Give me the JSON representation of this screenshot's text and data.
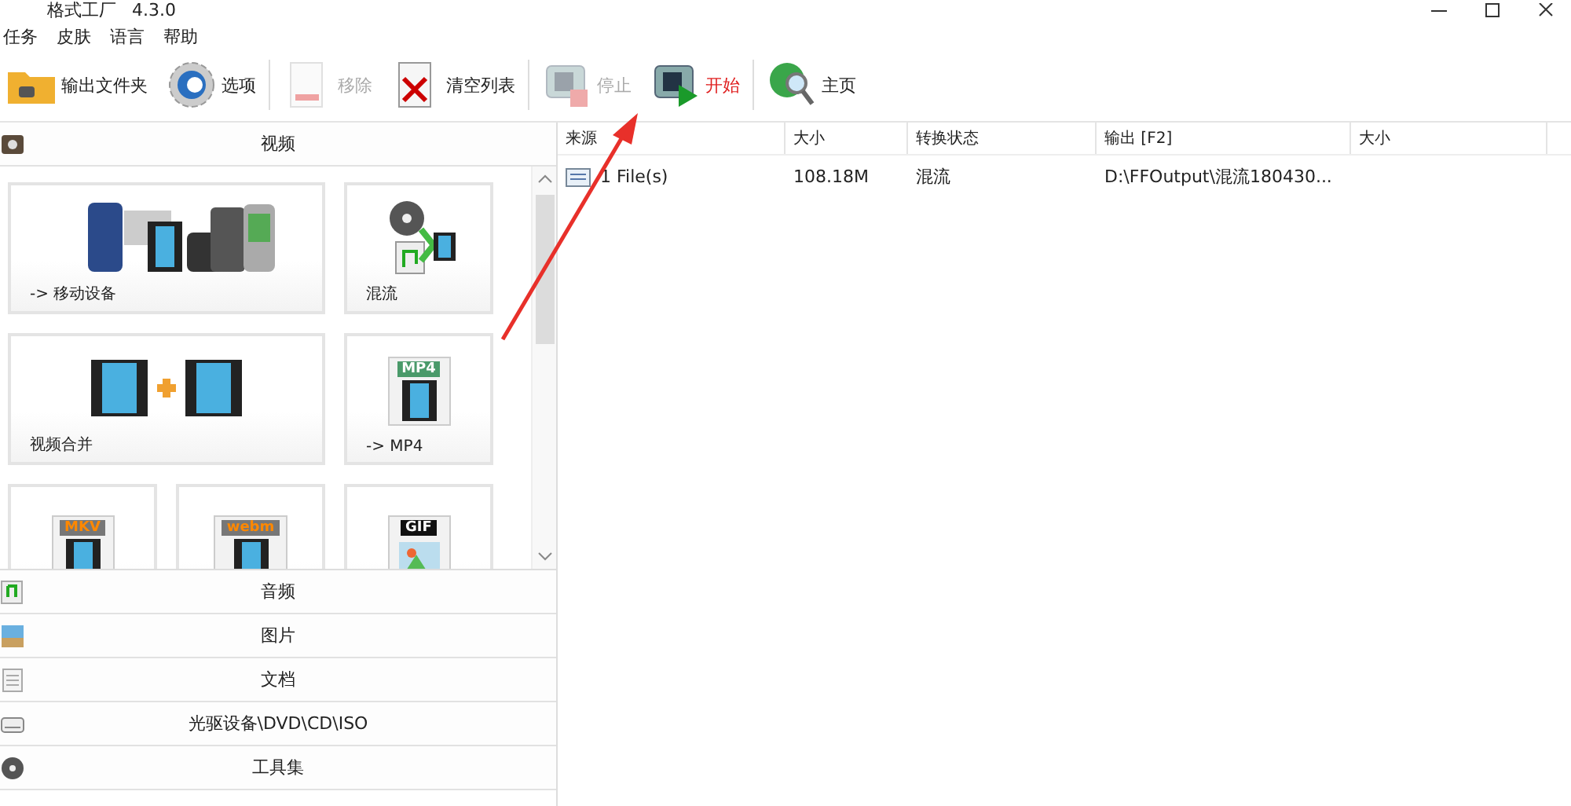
{
  "window": {
    "title": "格式工厂",
    "version": "4.3.0"
  },
  "menu": [
    "任务",
    "皮肤",
    "语言",
    "帮助"
  ],
  "toolbar": [
    {
      "label": "输出文件夹",
      "kind": "folder",
      "disabled": false,
      "accent": false
    },
    {
      "label": "选项",
      "kind": "gear",
      "disabled": false,
      "accent": false
    },
    {
      "label": "移除",
      "kind": "remove",
      "disabled": true,
      "accent": false
    },
    {
      "label": "清空列表",
      "kind": "clear",
      "disabled": false,
      "accent": false
    },
    {
      "label": "停止",
      "kind": "stop",
      "disabled": true,
      "accent": false
    },
    {
      "label": "开始",
      "kind": "start",
      "disabled": false,
      "accent": true
    },
    {
      "label": "主页",
      "kind": "home",
      "disabled": false,
      "accent": false
    }
  ],
  "sidebar": {
    "section": "视频",
    "tiles": [
      {
        "label": "-> 移动设备",
        "kind": "devices",
        "wide": true
      },
      {
        "label": "混流",
        "kind": "mux",
        "wide": false
      },
      {
        "label": "视频合并",
        "kind": "merge",
        "wide": true
      },
      {
        "label": "-> MP4",
        "kind": "format",
        "badge": "MP4",
        "wide": false
      },
      {
        "kind": "format",
        "badge": "MKV",
        "wide": false
      },
      {
        "kind": "format",
        "badge": "webm",
        "wide": false
      },
      {
        "kind": "gif",
        "badge": "GIF",
        "wide": false
      }
    ],
    "categories": [
      {
        "label": "音频",
        "kind": "audio"
      },
      {
        "label": "图片",
        "kind": "picture"
      },
      {
        "label": "文档",
        "kind": "document"
      },
      {
        "label": "光驱设备\\DVD\\CD\\ISO",
        "kind": "disc"
      },
      {
        "label": "工具集",
        "kind": "tools"
      }
    ]
  },
  "table": {
    "columns": [
      "来源",
      "大小",
      "转换状态",
      "输出 [F2]",
      "大小"
    ],
    "rows": [
      [
        "1 File(s)",
        "108.18M",
        "混流",
        "D:\\FFOutput\\混流180430...",
        ""
      ]
    ]
  }
}
